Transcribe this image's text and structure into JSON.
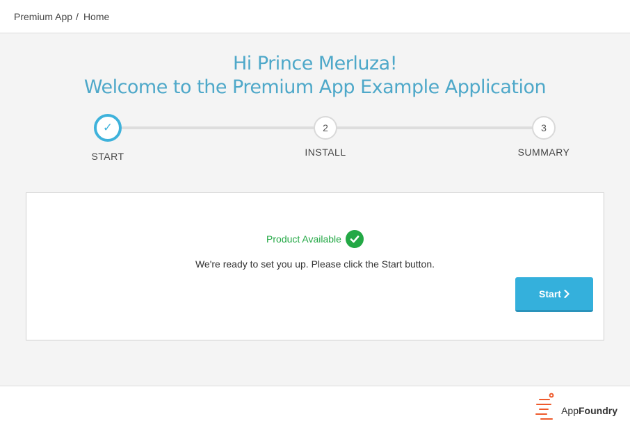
{
  "breadcrumb": {
    "app": "Premium App",
    "separator": "/",
    "page": "Home"
  },
  "header": {
    "greeting": "Hi Prince Merluza!",
    "welcome": "Welcome to the Premium App Example Application"
  },
  "steps": [
    {
      "number": "",
      "label": "START",
      "done": true
    },
    {
      "number": "2",
      "label": "INSTALL",
      "done": false
    },
    {
      "number": "3",
      "label": "SUMMARY",
      "done": false
    }
  ],
  "card": {
    "status": "Product Available",
    "message": "We're ready to set you up. Please click the Start button.",
    "start_label": "Start"
  },
  "footer": {
    "logo_part1": "App",
    "logo_part2": "Foundry"
  },
  "colors": {
    "accent": "#3eb2db",
    "heading": "#4ea8c9",
    "success": "#23a845",
    "logo": "#ee5a2c"
  },
  "icons": {
    "step_done": "check-icon",
    "status": "check-circle-icon",
    "button": "chevron-right-icon"
  }
}
